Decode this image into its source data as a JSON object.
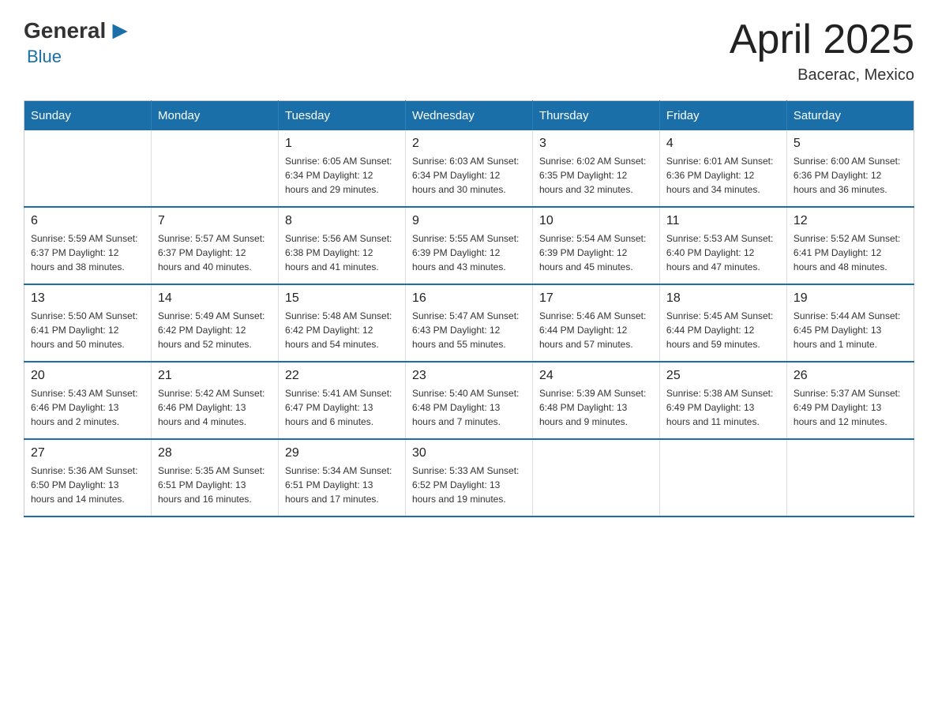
{
  "header": {
    "logo_general": "General",
    "logo_blue": "Blue",
    "title": "April 2025",
    "subtitle": "Bacerac, Mexico"
  },
  "calendar": {
    "days_of_week": [
      "Sunday",
      "Monday",
      "Tuesday",
      "Wednesday",
      "Thursday",
      "Friday",
      "Saturday"
    ],
    "weeks": [
      [
        {
          "day": "",
          "info": ""
        },
        {
          "day": "",
          "info": ""
        },
        {
          "day": "1",
          "info": "Sunrise: 6:05 AM\nSunset: 6:34 PM\nDaylight: 12 hours\nand 29 minutes."
        },
        {
          "day": "2",
          "info": "Sunrise: 6:03 AM\nSunset: 6:34 PM\nDaylight: 12 hours\nand 30 minutes."
        },
        {
          "day": "3",
          "info": "Sunrise: 6:02 AM\nSunset: 6:35 PM\nDaylight: 12 hours\nand 32 minutes."
        },
        {
          "day": "4",
          "info": "Sunrise: 6:01 AM\nSunset: 6:36 PM\nDaylight: 12 hours\nand 34 minutes."
        },
        {
          "day": "5",
          "info": "Sunrise: 6:00 AM\nSunset: 6:36 PM\nDaylight: 12 hours\nand 36 minutes."
        }
      ],
      [
        {
          "day": "6",
          "info": "Sunrise: 5:59 AM\nSunset: 6:37 PM\nDaylight: 12 hours\nand 38 minutes."
        },
        {
          "day": "7",
          "info": "Sunrise: 5:57 AM\nSunset: 6:37 PM\nDaylight: 12 hours\nand 40 minutes."
        },
        {
          "day": "8",
          "info": "Sunrise: 5:56 AM\nSunset: 6:38 PM\nDaylight: 12 hours\nand 41 minutes."
        },
        {
          "day": "9",
          "info": "Sunrise: 5:55 AM\nSunset: 6:39 PM\nDaylight: 12 hours\nand 43 minutes."
        },
        {
          "day": "10",
          "info": "Sunrise: 5:54 AM\nSunset: 6:39 PM\nDaylight: 12 hours\nand 45 minutes."
        },
        {
          "day": "11",
          "info": "Sunrise: 5:53 AM\nSunset: 6:40 PM\nDaylight: 12 hours\nand 47 minutes."
        },
        {
          "day": "12",
          "info": "Sunrise: 5:52 AM\nSunset: 6:41 PM\nDaylight: 12 hours\nand 48 minutes."
        }
      ],
      [
        {
          "day": "13",
          "info": "Sunrise: 5:50 AM\nSunset: 6:41 PM\nDaylight: 12 hours\nand 50 minutes."
        },
        {
          "day": "14",
          "info": "Sunrise: 5:49 AM\nSunset: 6:42 PM\nDaylight: 12 hours\nand 52 minutes."
        },
        {
          "day": "15",
          "info": "Sunrise: 5:48 AM\nSunset: 6:42 PM\nDaylight: 12 hours\nand 54 minutes."
        },
        {
          "day": "16",
          "info": "Sunrise: 5:47 AM\nSunset: 6:43 PM\nDaylight: 12 hours\nand 55 minutes."
        },
        {
          "day": "17",
          "info": "Sunrise: 5:46 AM\nSunset: 6:44 PM\nDaylight: 12 hours\nand 57 minutes."
        },
        {
          "day": "18",
          "info": "Sunrise: 5:45 AM\nSunset: 6:44 PM\nDaylight: 12 hours\nand 59 minutes."
        },
        {
          "day": "19",
          "info": "Sunrise: 5:44 AM\nSunset: 6:45 PM\nDaylight: 13 hours\nand 1 minute."
        }
      ],
      [
        {
          "day": "20",
          "info": "Sunrise: 5:43 AM\nSunset: 6:46 PM\nDaylight: 13 hours\nand 2 minutes."
        },
        {
          "day": "21",
          "info": "Sunrise: 5:42 AM\nSunset: 6:46 PM\nDaylight: 13 hours\nand 4 minutes."
        },
        {
          "day": "22",
          "info": "Sunrise: 5:41 AM\nSunset: 6:47 PM\nDaylight: 13 hours\nand 6 minutes."
        },
        {
          "day": "23",
          "info": "Sunrise: 5:40 AM\nSunset: 6:48 PM\nDaylight: 13 hours\nand 7 minutes."
        },
        {
          "day": "24",
          "info": "Sunrise: 5:39 AM\nSunset: 6:48 PM\nDaylight: 13 hours\nand 9 minutes."
        },
        {
          "day": "25",
          "info": "Sunrise: 5:38 AM\nSunset: 6:49 PM\nDaylight: 13 hours\nand 11 minutes."
        },
        {
          "day": "26",
          "info": "Sunrise: 5:37 AM\nSunset: 6:49 PM\nDaylight: 13 hours\nand 12 minutes."
        }
      ],
      [
        {
          "day": "27",
          "info": "Sunrise: 5:36 AM\nSunset: 6:50 PM\nDaylight: 13 hours\nand 14 minutes."
        },
        {
          "day": "28",
          "info": "Sunrise: 5:35 AM\nSunset: 6:51 PM\nDaylight: 13 hours\nand 16 minutes."
        },
        {
          "day": "29",
          "info": "Sunrise: 5:34 AM\nSunset: 6:51 PM\nDaylight: 13 hours\nand 17 minutes."
        },
        {
          "day": "30",
          "info": "Sunrise: 5:33 AM\nSunset: 6:52 PM\nDaylight: 13 hours\nand 19 minutes."
        },
        {
          "day": "",
          "info": ""
        },
        {
          "day": "",
          "info": ""
        },
        {
          "day": "",
          "info": ""
        }
      ]
    ]
  }
}
